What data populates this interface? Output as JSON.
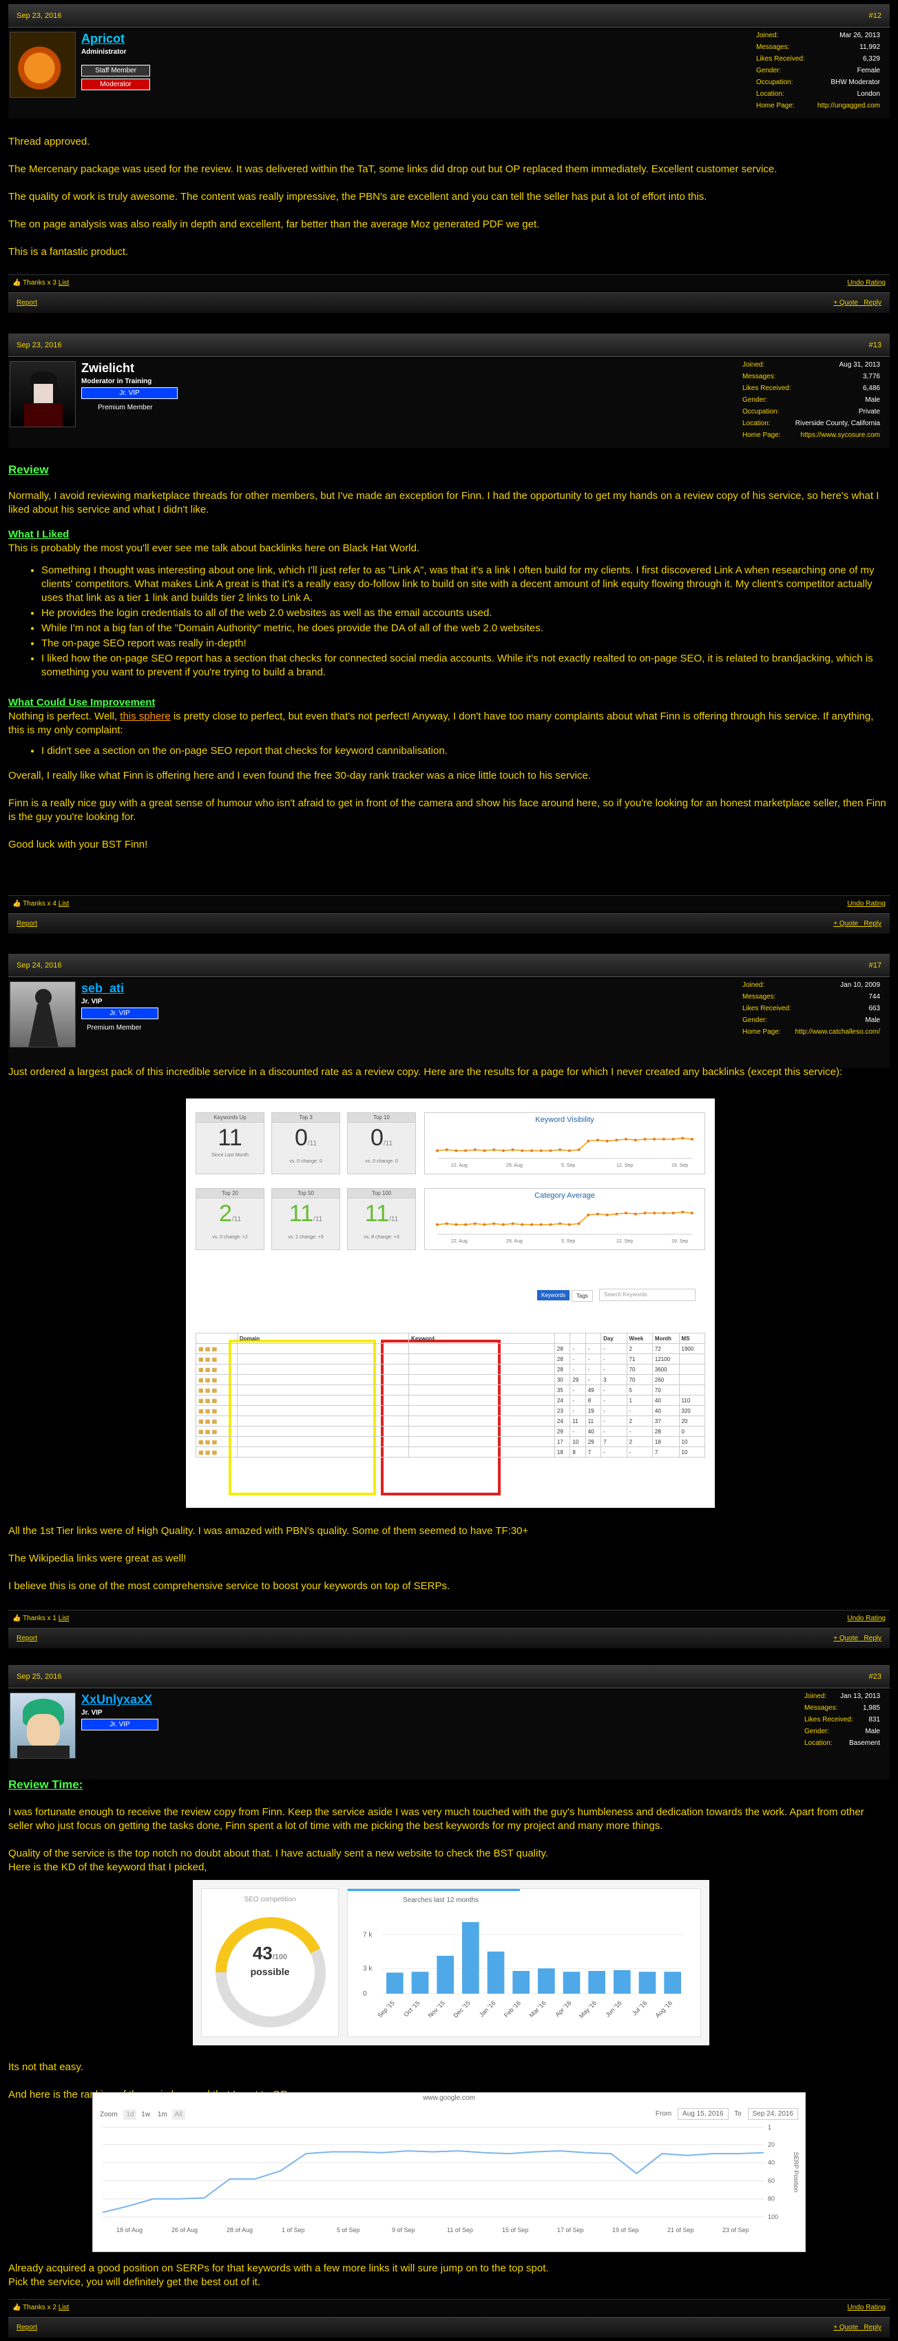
{
  "posts": [
    {
      "date": "Sep 23, 2016",
      "num": "#12",
      "user": {
        "name": "Apricot",
        "title1": "Administrator",
        "title2": "Staff Member",
        "banner": "Moderator",
        "info": [
          [
            "Joined:",
            "Mar 26, 2013"
          ],
          [
            "Messages:",
            "11,992"
          ],
          [
            "Likes Received:",
            "6,329"
          ],
          [
            "Gender:",
            "Female"
          ],
          [
            "Occupation:",
            "BHW Moderator"
          ],
          [
            "Location:",
            "London"
          ],
          [
            "Home Page:",
            "http://ungagged.com"
          ]
        ]
      },
      "paras": [
        "Thread approved.",
        "The Mercenary package was used for the review. It was delivered within the TaT, some links did drop out but OP replaced them immediately. Excellent customer service.",
        "The quality of work is truly awesome. The content was really impressive, the PBN's are excellent and you can tell the seller has put a lot of effort into this.",
        "The on page analysis was also really in depth and excellent, far better than the average Moz generated PDF we get.",
        "This is a fantastic product."
      ],
      "thanks": "Thanks x 3",
      "list": "List",
      "undo": "Undo Rating",
      "report": "Report",
      "quote": "+ Quote",
      "reply": "Reply"
    },
    {
      "date": "Sep 23, 2016",
      "num": "#13",
      "user": {
        "name": "Zwielicht",
        "title1": "Moderator in Training",
        "banner": "Jr. VIP",
        "premium": "Premium Member",
        "info": [
          [
            "Joined:",
            "Aug 31, 2013"
          ],
          [
            "Messages:",
            "3,776"
          ],
          [
            "Likes Received:",
            "6,486"
          ],
          [
            "Gender:",
            "Male"
          ],
          [
            "Occupation:",
            "Private"
          ],
          [
            "Location:",
            "Riverside County, California"
          ],
          [
            "Home Page:",
            "https://www.sycosure.com"
          ]
        ]
      },
      "review": "Review",
      "p1": "Normally, I avoid reviewing marketplace threads for other members, but I've made an exception for Finn. I had the opportunity to get my hands on a review copy of his service, so here's what I liked about his service and what I didn't like.",
      "liked": "What I Liked",
      "liked_sub": "This is probably the most you'll ever see me talk about backlinks here on Black Hat World.",
      "likes": [
        "Something I thought was interesting about one link, which I'll just refer to as \"Link A\", was that it's a link I often build for my clients. I first discovered Link A when researching one of my clients' competitors. What makes Link A great is that it's a really easy do-follow link to build on site with a decent amount of link equity flowing through it. My client's competitor actually uses that link as a tier 1 link and builds tier 2 links to Link A.",
        "He provides the login credentials to all of the web 2.0 websites as well as the email accounts used.",
        "While I'm not a big fan of the \"Domain Authority\" metric, he does provide the DA of all of the web 2.0 websites.",
        "The on-page SEO report was really in-depth!",
        "I liked how the on-page SEO report has a section that checks for connected social media accounts. While it's not exactly realted to on-page SEO, it is related to brandjacking, which is something you want to prevent if you're trying to build a brand."
      ],
      "improve": "What Could Use Improvement",
      "imp_a": "Nothing is perfect. Well, ",
      "imp_link": "this sphere",
      "imp_b": " is pretty close to perfect, but even that's not perfect! Anyway, I don't have too many complaints about what Finn is offering through his service. If anything, this is my only complaint:",
      "complaints": [
        "I didn't see a section on the on-page SEO report that checks for keyword cannibalisation."
      ],
      "p2": "Overall, I really like what Finn is offering here and I even found the free 30-day rank tracker was a nice little touch to his service.",
      "p3": "Finn is a really nice guy with a great sense of humour who isn't afraid to get in front of the camera and show his face around here, so if you're looking for an honest marketplace seller, then Finn is the guy you're looking for.",
      "p4": "Good luck with your BST Finn!",
      "thanks": "Thanks x 4",
      "list": "List",
      "undo": "Undo Rating",
      "report": "Report",
      "quote": "+ Quote",
      "reply": "Reply"
    },
    {
      "date": "Sep 24, 2016",
      "num": "#17",
      "user": {
        "name": "seb_ati",
        "title1": "Jr. VIP",
        "banner": "Jr. VIP",
        "premium": "Premium Member",
        "info": [
          [
            "Joined:",
            "Jan 10, 2009"
          ],
          [
            "Messages:",
            "744"
          ],
          [
            "Likes Received:",
            "663"
          ],
          [
            "Gender:",
            "Male"
          ],
          [
            "Home Page:",
            "http://www.catchalleso.com/"
          ]
        ]
      },
      "p1": "Just ordered a largest pack of this incredible service in a discounted rate as a review copy. Here are the results for a page for which I never created any backlinks (except this service):",
      "cards": [
        {
          "t": "Keywords Up",
          "v": "11",
          "s": "Since Last Month"
        },
        {
          "t": "Top 3",
          "v": "0",
          "u": "/11",
          "s": "vs. 0 change: 0"
        },
        {
          "t": "Top 10",
          "v": "0",
          "u": "/11",
          "s": "vs. 0 change: 0"
        },
        {
          "t": "Top 20",
          "v": "2",
          "u": "/11",
          "s": "vs. 0 change: +2"
        },
        {
          "t": "Top 50",
          "v": "11",
          "u": "/11",
          "s": "vs. 2 change: +9"
        },
        {
          "t": "Top 100",
          "v": "11",
          "u": "/11",
          "s": "vs. 8 change: +3"
        }
      ],
      "vis_title": "Keyword Visibility",
      "cat_title": "Category Average",
      "tabs": [
        "Keywords",
        "Tags"
      ],
      "search_ph": "Search Keywords",
      "cols": [
        "",
        "Domain",
        "Keyword",
        "",
        "",
        "",
        "Day",
        "Week",
        "Month",
        "MS"
      ],
      "rows": [
        [
          "28",
          "-",
          "-",
          "-",
          "2",
          "72",
          "1900"
        ],
        [
          "28",
          "-",
          "-",
          "-",
          "71",
          "12100"
        ],
        [
          "28",
          "-",
          "-",
          "-",
          "70",
          "3600"
        ],
        [
          "30",
          "29",
          "-",
          "3",
          "70",
          "260"
        ],
        [
          "35",
          "-",
          "49",
          "-",
          "5",
          "70"
        ],
        [
          "24",
          "-",
          "8",
          "-",
          "1",
          "40",
          "110"
        ],
        [
          "23",
          "-",
          "19",
          "-",
          "-",
          "40",
          "320"
        ],
        [
          "24",
          "11",
          "11",
          "-",
          "2",
          "37",
          "20"
        ],
        [
          "29",
          "-",
          "40",
          "-",
          "-",
          "28",
          "0"
        ],
        [
          "17",
          "10",
          "29",
          "7",
          "2",
          "18",
          "10"
        ],
        [
          "18",
          "8",
          "7",
          "-",
          "-",
          "7",
          "10"
        ]
      ],
      "p2": "All the 1st Tier links were of High Quality. I was amazed with PBN's quality. Some of them seemed to have TF:30+",
      "p3": "The Wikipedia links were great as well!",
      "p4": "I believe this is one of the most comprehensive service to boost your keywords on top of SERPs.",
      "thanks": "Thanks x 1",
      "list": "List",
      "undo": "Undo Rating",
      "report": "Report",
      "quote": "+ Quote",
      "reply": "Reply"
    },
    {
      "date": "Sep 25, 2016",
      "num": "#23",
      "user": {
        "name": "XxUnlyxaxX",
        "title1": "Jr. VIP",
        "banner": "Jr. VIP",
        "info": [
          [
            "Joined:",
            "Jan 13, 2013"
          ],
          [
            "Messages:",
            "1,985"
          ],
          [
            "Likes Received:",
            "831"
          ],
          [
            "Gender:",
            "Male"
          ],
          [
            "Location:",
            "Basement"
          ]
        ]
      },
      "review": "Review Time:",
      "p1": "I was fortunate enough to receive the review copy from Finn. Keep the service aside I was very much touched with the guy's humbleness and dedication towards the work. Apart from other seller who just focus on getting the tasks done, Finn spent a lot of time with me picking the best keywords for my project and many more things.",
      "p2a": "Quality of the service is the top notch no doubt about that. I have actually sent a new website to check the BST quality.",
      "p2b": "Here is the KD of the keyword that I picked,",
      "kd_title": "SEO competition",
      "kd_value": "43",
      "kd_total": "/100",
      "kd_label": "possible",
      "bar_title": "Searches last 12 months",
      "bar_months": [
        "Sep '15",
        "Oct '15",
        "Nov '15",
        "Dec '15",
        "Jan '16",
        "Feb '16",
        "Mar '16",
        "Apr '16",
        "May '16",
        "Jun '16",
        "Jul '16",
        "Aug '16"
      ],
      "bar_yticks": [
        "7 k",
        "3 k",
        "0"
      ],
      "p3": "Its not that easy.",
      "p4": "And here is the ranking of the main keyword that I sent to OP.",
      "rank_site": "www.google.com",
      "zoom": "Zoom",
      "zoom_opts": [
        "1d",
        "1w",
        "1m",
        "All"
      ],
      "from_label": "From",
      "from": "Aug 15, 2016",
      "to_label": "To",
      "to": "Sep 24, 2016",
      "rank_x": [
        "18 of Aug",
        "26 of Aug",
        "28 of Aug",
        "1 of Sep",
        "5 of Sep",
        "9 of Sep",
        "11 of Sep",
        "15 of Sep",
        "17 of Sep",
        "19 of Sep",
        "21 of Sep",
        "23 of Sep"
      ],
      "rank_yticks": [
        "1",
        "20",
        "40",
        "60",
        "80",
        "100"
      ],
      "rank_ylabel": "SERP Position",
      "p5a": "Already acquired a good position on SERPs for that keywords with a few more links it will sure jump on to the top spot.",
      "p5b": "Pick the service, you will definitely get the best out of it.",
      "thanks": "Thanks x 2",
      "list": "List",
      "undo": "Undo Rating",
      "report": "Report",
      "quote": "+ Quote",
      "reply": "Reply"
    }
  ],
  "chart_data": [
    {
      "type": "line",
      "title": "Keyword Visibility",
      "x": [
        "22. Aug",
        "29. Aug",
        "5. Sep",
        "12. Sep",
        "19. Sep"
      ],
      "series": [
        {
          "values": [
            18,
            19,
            18,
            18,
            19,
            18,
            19,
            18,
            19,
            18,
            18,
            18,
            18,
            19,
            18,
            19,
            28,
            29,
            28,
            29,
            30,
            29,
            30,
            30,
            30,
            30,
            31,
            30
          ]
        }
      ],
      "ylim": [
        0,
        110
      ]
    },
    {
      "type": "line",
      "title": "Category Average",
      "x": [
        "22. Aug",
        "29. Aug",
        "5. Sep",
        "12. Sep",
        "19. Sep"
      ],
      "series": [
        {
          "values": [
            20,
            21,
            20,
            20,
            21,
            20,
            21,
            20,
            21,
            20,
            20,
            20,
            20,
            21,
            20,
            21,
            30,
            31,
            30,
            31,
            32,
            31,
            32,
            32,
            32,
            32,
            33,
            32
          ]
        }
      ]
    },
    {
      "type": "bar",
      "title": "Searches last 12 months",
      "categories": [
        "Sep '15",
        "Oct '15",
        "Nov '15",
        "Dec '15",
        "Jan '16",
        "Feb '16",
        "Mar '16",
        "Apr '16",
        "May '16",
        "Jun '16",
        "Jul '16",
        "Aug '16"
      ],
      "values": [
        2500,
        2600,
        4500,
        8500,
        5000,
        2700,
        3000,
        2600,
        2700,
        2800,
        2600,
        2600
      ]
    },
    {
      "type": "line",
      "title": "www.google.com",
      "x": [
        "18 of Aug",
        "26 of Aug",
        "28 of Aug",
        "1 of Sep",
        "5 of Sep",
        "9 of Sep",
        "11 of Sep",
        "15 of Sep",
        "17 of Sep",
        "19 of Sep",
        "21 of Sep",
        "23 of Sep"
      ],
      "ylabel": "SERP Position",
      "series": [
        {
          "values": [
            95,
            88,
            80,
            80,
            79,
            58,
            58,
            49,
            30,
            28,
            28,
            29,
            27,
            28,
            27,
            29,
            30,
            28,
            27,
            29,
            30,
            52,
            30,
            32,
            30,
            30,
            29
          ]
        }
      ],
      "ylim": [
        100,
        1
      ]
    }
  ]
}
